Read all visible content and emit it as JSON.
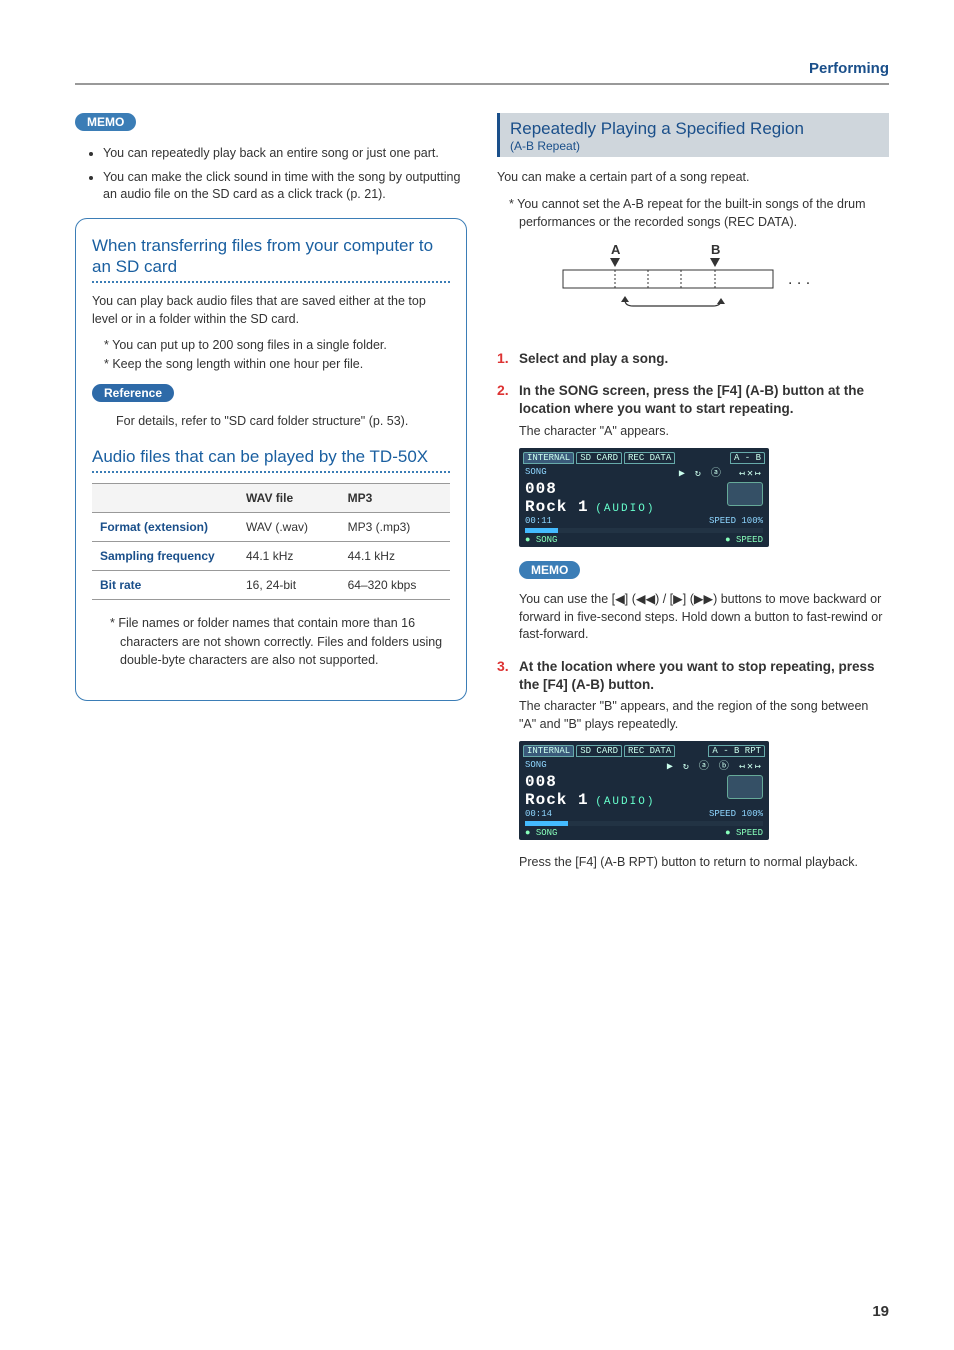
{
  "header": {
    "section": "Performing"
  },
  "memo1": {
    "label": "MEMO",
    "bullets": [
      "You can repeatedly play back an entire song or just one part.",
      "You can make the click sound in time with the song by outputting an audio file on the SD card as a click track (p. 21)."
    ]
  },
  "infobox": {
    "h1": "When transferring files from your computer to an SD card",
    "p1": "You can play back audio files that are saved either at the top level or in a folder within the SD card.",
    "stars": [
      "You can put up to 200 song files in a single folder.",
      "Keep the song length within one hour per file."
    ],
    "refLabel": "Reference",
    "refText": "For details, refer to \"SD card folder structure\" (p. 53).",
    "h2": "Audio files that can be played by the TD-50X",
    "table": {
      "headCol1": "WAV file",
      "headCol2": "MP3",
      "rows": [
        {
          "label": "Format (extension)",
          "c1": "WAV (.wav)",
          "c2": "MP3 (.mp3)"
        },
        {
          "label": "Sampling frequency",
          "c1": "44.1 kHz",
          "c2": "44.1 kHz"
        },
        {
          "label": "Bit rate",
          "c1": "16, 24-bit",
          "c2": "64–320 kbps"
        }
      ]
    },
    "footnote": "File names or folder names that contain more than 16 characters are not shown correctly. Files and folders using double-byte characters are also not supported."
  },
  "ab": {
    "title": "Repeatedly Playing a Specified Region",
    "sub": "(A-B Repeat)",
    "intro": "You can make a certain part of a song repeat.",
    "note": "You cannot set the A-B repeat for the built-in songs of the drum performances or the recorded songs (REC DATA).",
    "diagram": {
      "a": "A",
      "b": "B",
      "dots": ". . ."
    },
    "steps": [
      {
        "title": "Select and play a song."
      },
      {
        "title": "In the SONG screen, press the [F4] (A-B) button at the location where you want to start repeating.",
        "body": "The character \"A\" appears.",
        "screen": {
          "tabs": [
            "INTERNAL",
            "SD CARD",
            "REC DATA",
            "A - B"
          ],
          "label": "SONG",
          "num": "008",
          "name": "Rock 1",
          "type": "(AUDIO)",
          "time": "00:11",
          "speed": "SPEED 100%",
          "foot1": "SONG",
          "foot2": "SPEED"
        }
      },
      {
        "title": "At the location where you want to stop repeating, press the [F4] (A-B) button.",
        "body": "The character \"B\" appears, and the region of the song between \"A\" and \"B\" plays repeatedly.",
        "screen": {
          "tabs": [
            "INTERNAL",
            "SD CARD",
            "REC DATA",
            "A - B RPT"
          ],
          "label": "SONG",
          "num": "008",
          "name": "Rock 1",
          "type": "(AUDIO)",
          "time": "00:14",
          "speed": "SPEED 100%",
          "foot1": "SONG",
          "foot2": "SPEED"
        },
        "after": "Press the [F4] (A-B RPT) button to return to normal playback."
      }
    ],
    "memo2": {
      "label": "MEMO",
      "text": "You can use the [◀] (◀◀) / [▶] (▶▶) buttons to move backward or forward in five-second steps. Hold down a button to fast-rewind or fast-forward."
    }
  },
  "pageNumber": "19"
}
